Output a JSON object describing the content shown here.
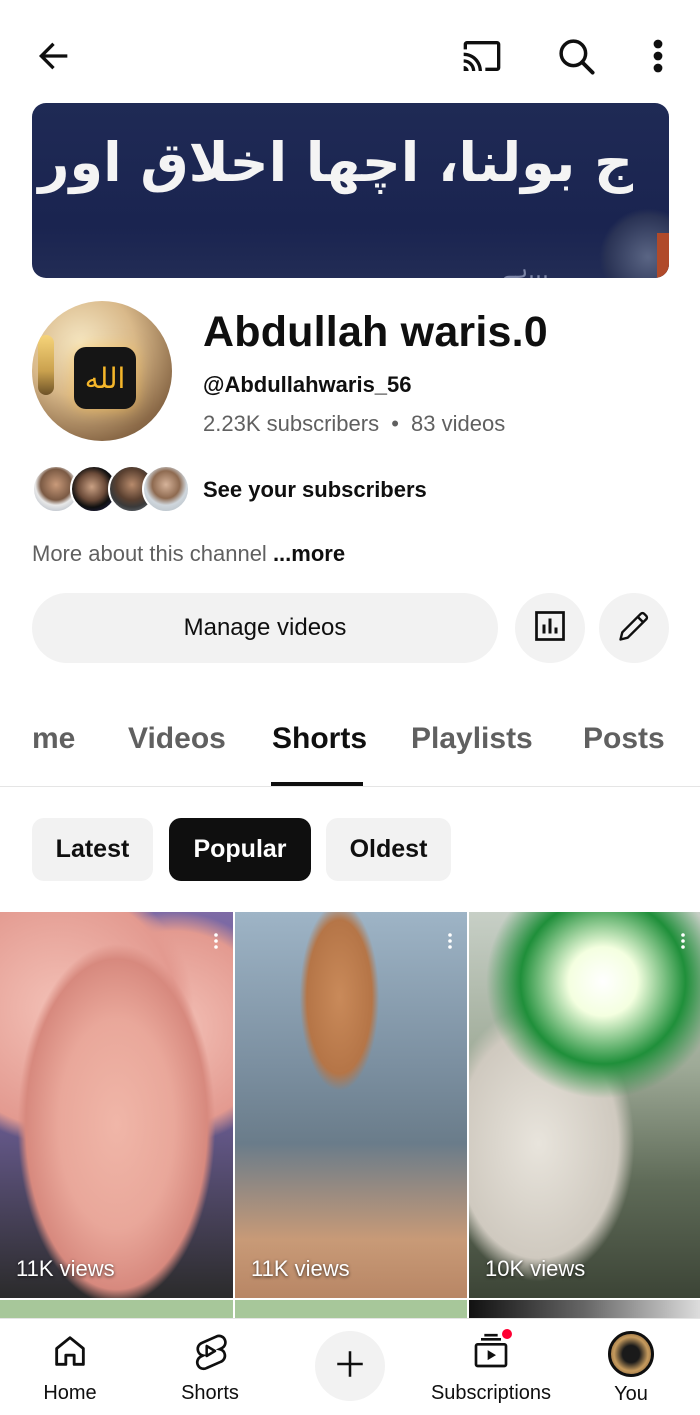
{
  "header": {
    "back_icon": "arrow-left-icon",
    "cast_icon": "cast-icon",
    "search_icon": "search-icon",
    "more_icon": "more-vertical-icon"
  },
  "banner": {
    "text": "ج بولنا، اچھا اخلاق اور پاکیزہ حلال لقمہ",
    "subtext": "...ہے"
  },
  "channel": {
    "name": "Abdullah waris.0",
    "handle": "@Abdullahwaris_56",
    "subscribers": "2.23K subscribers",
    "separator": "•",
    "videos": "83 videos",
    "see_subscribers": "See your subscribers",
    "more_about": "More about this channel",
    "more_link": " ...more"
  },
  "actions": {
    "manage_videos": "Manage videos",
    "analytics_icon": "analytics-icon",
    "edit_icon": "pencil-icon"
  },
  "tabs": [
    {
      "label": "me"
    },
    {
      "label": "Videos"
    },
    {
      "label": "Shorts"
    },
    {
      "label": "Playlists"
    },
    {
      "label": "Posts"
    }
  ],
  "active_tab": "Shorts",
  "chips": [
    {
      "label": "Latest"
    },
    {
      "label": "Popular"
    },
    {
      "label": "Oldest"
    }
  ],
  "active_chip": "Popular",
  "shorts": [
    {
      "views": "11K views"
    },
    {
      "views": "11K views"
    },
    {
      "views": "10K views"
    }
  ],
  "bottom_nav": {
    "home": "Home",
    "shorts": "Shorts",
    "create_icon": "plus-icon",
    "subscriptions": "Subscriptions",
    "you": "You"
  },
  "colors": {
    "accent": "#0f0f0f",
    "secondary_text": "#606060",
    "chip_bg": "#f2f2f2",
    "notification": "#ff0033"
  }
}
